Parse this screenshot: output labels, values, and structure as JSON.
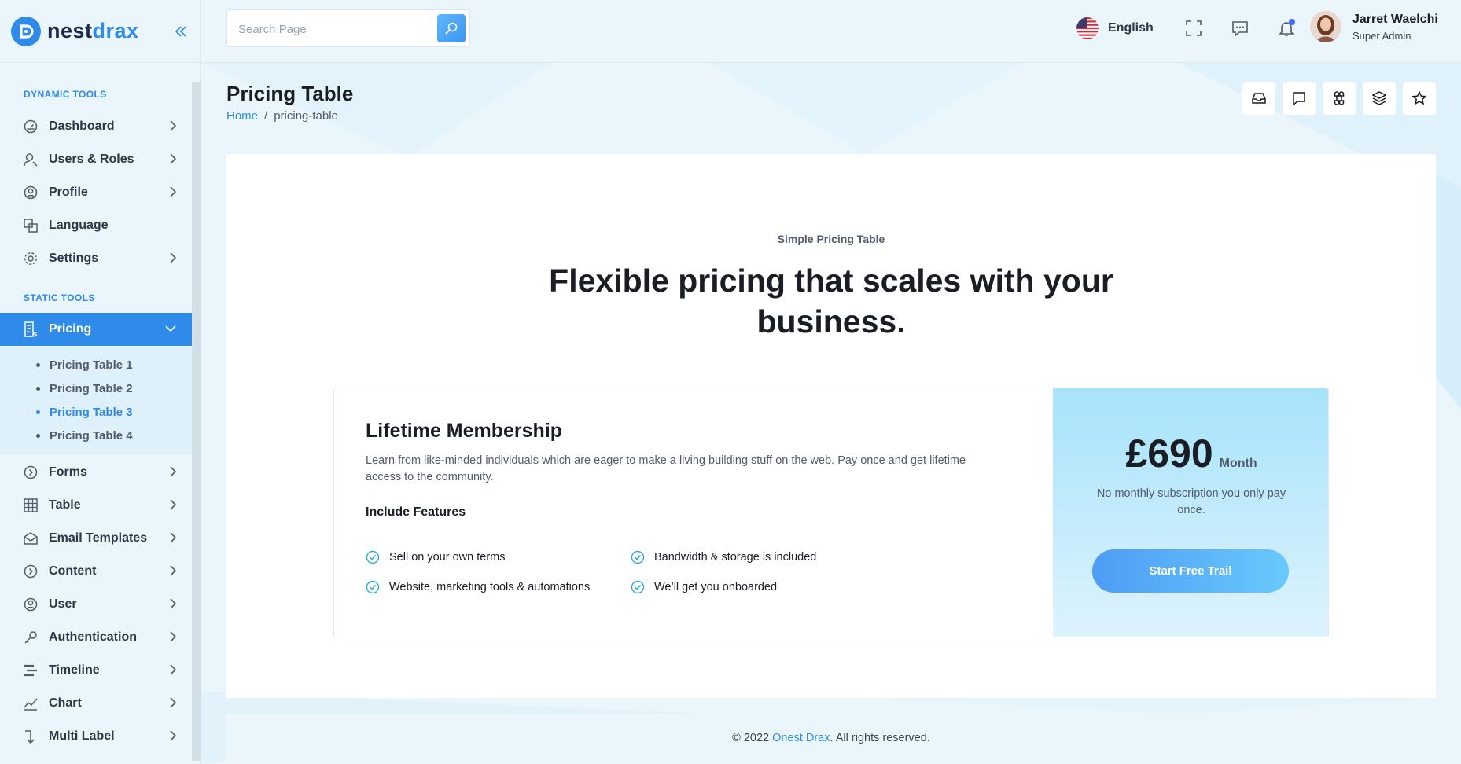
{
  "brand": {
    "name_a": "nest",
    "name_b": "drax",
    "accent": "#2f8bea"
  },
  "sidebar": {
    "section_dynamic": "DYNAMIC TOOLS",
    "section_static": "STATIC TOOLS",
    "items": [
      {
        "label": "Dashboard",
        "icon": "gauge-icon"
      },
      {
        "label": "Users & Roles",
        "icon": "user-roles-icon"
      },
      {
        "label": "Profile",
        "icon": "profile-icon"
      },
      {
        "label": "Language",
        "icon": "translate-icon"
      },
      {
        "label": "Settings",
        "icon": "gear-icon"
      },
      {
        "label": "Pricing",
        "icon": "pricing-icon"
      },
      {
        "label": "Forms",
        "icon": "chevron-circle-icon"
      },
      {
        "label": "Table",
        "icon": "grid-icon"
      },
      {
        "label": "Email Templates",
        "icon": "mail-icon"
      },
      {
        "label": "Content",
        "icon": "chevron-circle-icon"
      },
      {
        "label": "User",
        "icon": "user-circle-icon"
      },
      {
        "label": "Authentication",
        "icon": "key-icon"
      },
      {
        "label": "Timeline",
        "icon": "timeline-icon"
      },
      {
        "label": "Chart",
        "icon": "chart-icon"
      },
      {
        "label": "Multi Label",
        "icon": "corner-down-icon"
      }
    ],
    "pricing_sub": [
      "Pricing Table 1",
      "Pricing Table 2",
      "Pricing Table 3",
      "Pricing Table 4"
    ]
  },
  "topbar": {
    "search_placeholder": "Search Page",
    "language": "English",
    "user_name": "Jarret Waelchi",
    "user_role": "Super Admin"
  },
  "page": {
    "title": "Pricing Table",
    "breadcrumb_home": "Home",
    "breadcrumb_sep": "/",
    "breadcrumb_current": "pricing-table"
  },
  "pricing": {
    "eyebrow": "Simple Pricing Table",
    "headline": "Flexible pricing that scales with your business.",
    "plan_name": "Lifetime Membership",
    "plan_desc": "Learn from like-minded individuals which are eager to make a living building stuff on the web. Pay once and get lifetime access to the community.",
    "features_title": "Include Features",
    "features": [
      "Sell on your own terms",
      "Bandwidth & storage is included",
      "Website, marketing tools & automations",
      "We’ll get you onboarded"
    ],
    "price": "£690",
    "period": "Month",
    "price_note": "No monthly subscription you only pay once.",
    "cta": "Start Free Trail"
  },
  "footer": {
    "prefix": "© 2022 ",
    "brand": "Onest Drax",
    "suffix": ". All rights reserved."
  }
}
